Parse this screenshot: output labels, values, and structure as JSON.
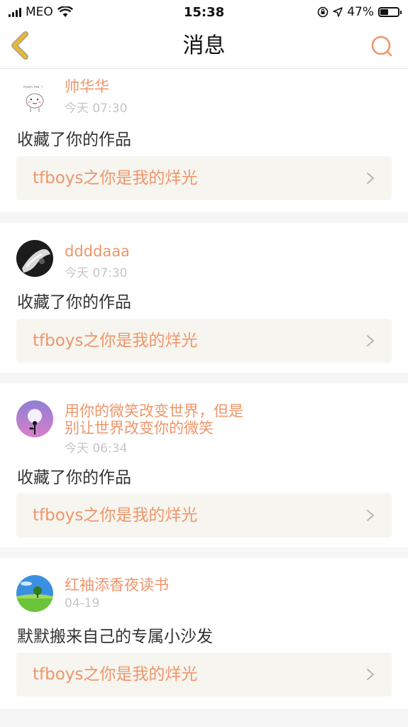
{
  "status_bar": {
    "carrier": "MEO",
    "time": "15:38",
    "battery_percent": "47%",
    "battery_level": 0.47
  },
  "nav": {
    "title": "消息"
  },
  "colors": {
    "accent": "#ef956a",
    "back_icon": "#e8b92e",
    "muted": "#c6c6c6"
  },
  "messages": [
    {
      "user": "帅华华",
      "time": "今天 07:30",
      "action": "收藏了你的作品",
      "work": "tfboys之你是我的烊光",
      "avatar_icon": "cartoon-avatar-icon"
    },
    {
      "user": "ddddaaa",
      "time": "今天 07:30",
      "action": "收藏了你的作品",
      "work": "tfboys之你是我的烊光",
      "avatar_icon": "dark-photo-avatar-icon"
    },
    {
      "user": "用你的微笑改变世界，但是别让世界改变你的微笑",
      "time": "今天 06:34",
      "action": "收藏了你的作品",
      "work": "tfboys之你是我的烊光",
      "avatar_icon": "moon-avatar-icon"
    },
    {
      "user": "红袖添香夜读书",
      "time": "04-19",
      "action": "默默搬来自己的专属小沙发",
      "work": "tfboys之你是我的烊光",
      "avatar_icon": "landscape-avatar-icon"
    }
  ]
}
